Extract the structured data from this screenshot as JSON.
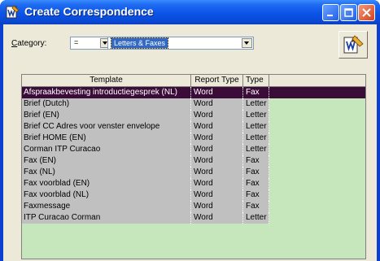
{
  "window": {
    "title": "Create Correspondence"
  },
  "filter": {
    "category_label": "Category:",
    "operator_value": "=",
    "category_value": "Letters & Faxes"
  },
  "grid": {
    "columns": [
      "Template",
      "Report Type",
      "Type"
    ],
    "rows": [
      {
        "template": "Afspraakbevesting introductiegesprek (NL)",
        "report_type": "Word",
        "type": "Fax",
        "selected": true
      },
      {
        "template": "Brief (Dutch)",
        "report_type": "Word",
        "type": "Letter"
      },
      {
        "template": "Brief (EN)",
        "report_type": "Word",
        "type": "Letter"
      },
      {
        "template": "Brief CC Adres voor venster envelope",
        "report_type": "Word",
        "type": "Letter"
      },
      {
        "template": "Brief HOME (EN)",
        "report_type": "Word",
        "type": "Letter"
      },
      {
        "template": "Corman ITP Curacao",
        "report_type": "Word",
        "type": "Letter"
      },
      {
        "template": "Fax (EN)",
        "report_type": "Word",
        "type": "Fax"
      },
      {
        "template": "Fax (NL)",
        "report_type": "Word",
        "type": "Fax"
      },
      {
        "template": "Fax voorblad (EN)",
        "report_type": "Word",
        "type": "Fax"
      },
      {
        "template": "Fax voorblad (NL)",
        "report_type": "Word",
        "type": "Fax"
      },
      {
        "template": "Faxmessage",
        "report_type": "Word",
        "type": "Fax"
      },
      {
        "template": "ITP Curacao Corman",
        "report_type": "Word",
        "type": "Letter"
      }
    ]
  },
  "colors": {
    "selected_row": "#3c0c39",
    "grid_bg": "#c5e7bb",
    "cell_bg": "#c0c0c0"
  },
  "icons": {
    "app": "word-doc-icon",
    "wizard": "document-wizard-icon"
  }
}
